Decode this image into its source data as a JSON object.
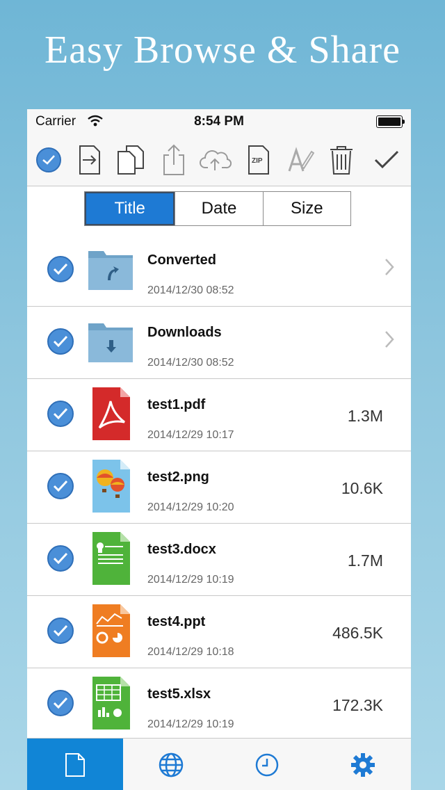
{
  "headline": "Easy Browse & Share",
  "status_bar": {
    "carrier": "Carrier",
    "time": "8:54 PM"
  },
  "toolbar": {
    "icons": [
      "select-all-icon",
      "move-icon",
      "copy-icon",
      "share-icon",
      "cloud-upload-icon",
      "zip-icon",
      "rename-icon",
      "trash-icon",
      "done-checkmark-icon"
    ],
    "zip_label": "ZIP"
  },
  "sort": {
    "options": [
      "Title",
      "Date",
      "Size"
    ],
    "selected": "Title"
  },
  "files": [
    {
      "name": "Converted",
      "date": "2014/12/30 08:52",
      "size": "",
      "type": "folder",
      "icon": "folder-converted-icon"
    },
    {
      "name": "Downloads",
      "date": "2014/12/30 08:52",
      "size": "",
      "type": "folder",
      "icon": "folder-downloads-icon"
    },
    {
      "name": "test1.pdf",
      "date": "2014/12/29 10:17",
      "size": "1.3M",
      "type": "pdf",
      "icon": "pdf-file-icon"
    },
    {
      "name": "test2.png",
      "date": "2014/12/29 10:20",
      "size": "10.6K",
      "type": "png",
      "icon": "image-file-icon"
    },
    {
      "name": "test3.docx",
      "date": "2014/12/29 10:19",
      "size": "1.7M",
      "type": "docx",
      "icon": "word-file-icon"
    },
    {
      "name": "test4.ppt",
      "date": "2014/12/29 10:18",
      "size": "486.5K",
      "type": "ppt",
      "icon": "powerpoint-file-icon"
    },
    {
      "name": "test5.xlsx",
      "date": "2014/12/29 10:19",
      "size": "172.3K",
      "type": "xlsx",
      "icon": "excel-file-icon"
    }
  ],
  "tabs": [
    {
      "icon": "files-tab-icon",
      "active": true
    },
    {
      "icon": "web-tab-icon",
      "active": false
    },
    {
      "icon": "recent-tab-icon",
      "active": false
    },
    {
      "icon": "settings-tab-icon",
      "active": false
    }
  ],
  "colors": {
    "accent": "#1e7ad4",
    "check": "#4a8fd8",
    "tab_active": "#1185d6",
    "pdf": "#d42a2a",
    "docx": "#4fb33a",
    "ppt": "#ef7d22",
    "xlsx": "#4fb33a"
  }
}
